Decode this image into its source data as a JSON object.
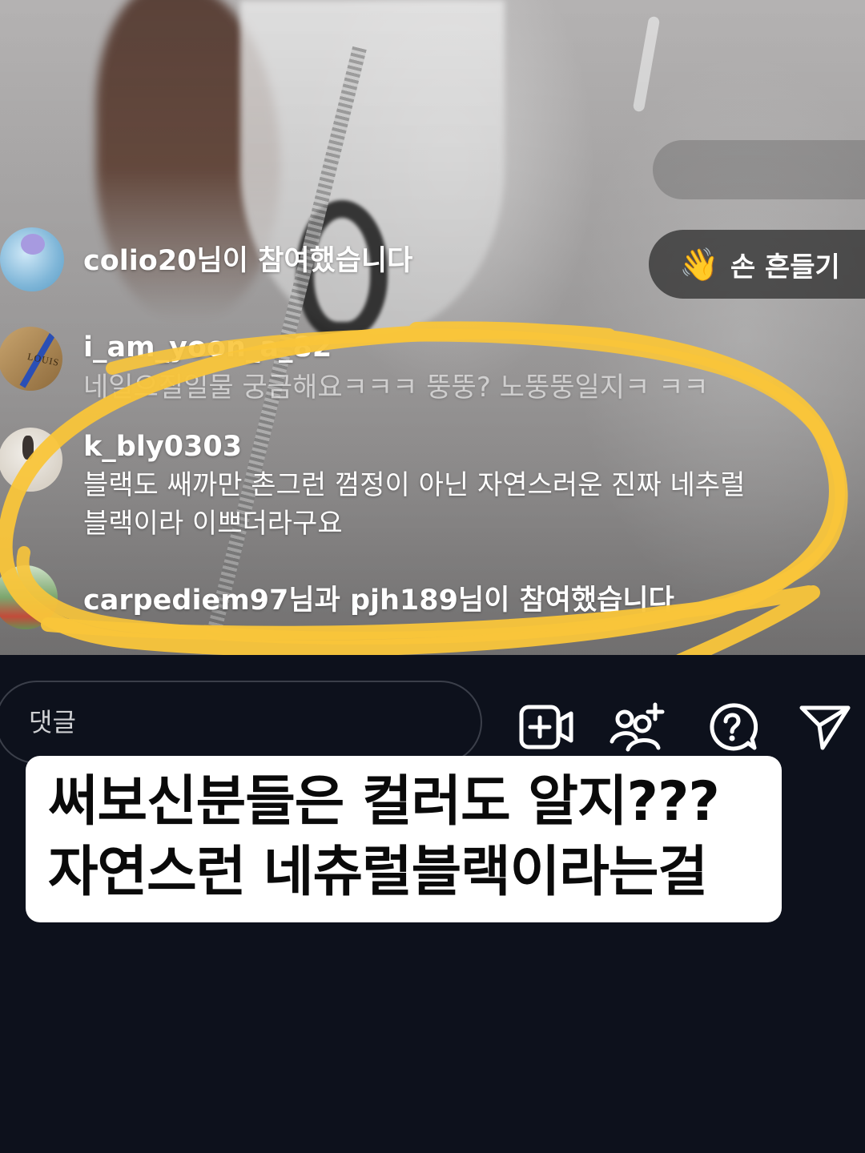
{
  "comments": [
    {
      "text": "colio20님이 참여했습니다"
    },
    {
      "user": "i_am_yoon_a_82",
      "text": "네일으질일물 궁금해요ㅋㅋㅋ 뚱뚱? 노뚱뚱일지ㅋ ㅋㅋ"
    },
    {
      "user": "k_bly0303",
      "line1": "블랙도 쌔까만 촌그런 껌정이 아닌 자연스러운 진짜 네추럴",
      "line2": "블랙이라 이쁘더라구요"
    },
    {
      "text": "carpediem97님과 pjh189님이 참여했습니다"
    }
  ],
  "avatar2_label": "LOUIS",
  "wave": {
    "emoji": "👋",
    "label": "손 흔들기"
  },
  "input": {
    "placeholder": "댓글"
  },
  "caption": {
    "line1": "써보신분들은 컬러도 알지???",
    "line2": "자연스런 네츄럴블랙이라는걸"
  },
  "colors": {
    "highlight": "#f9c53a",
    "background": "#0d111c"
  },
  "icons": [
    "add-video-icon",
    "invite-people-icon",
    "question-icon",
    "send-icon"
  ]
}
